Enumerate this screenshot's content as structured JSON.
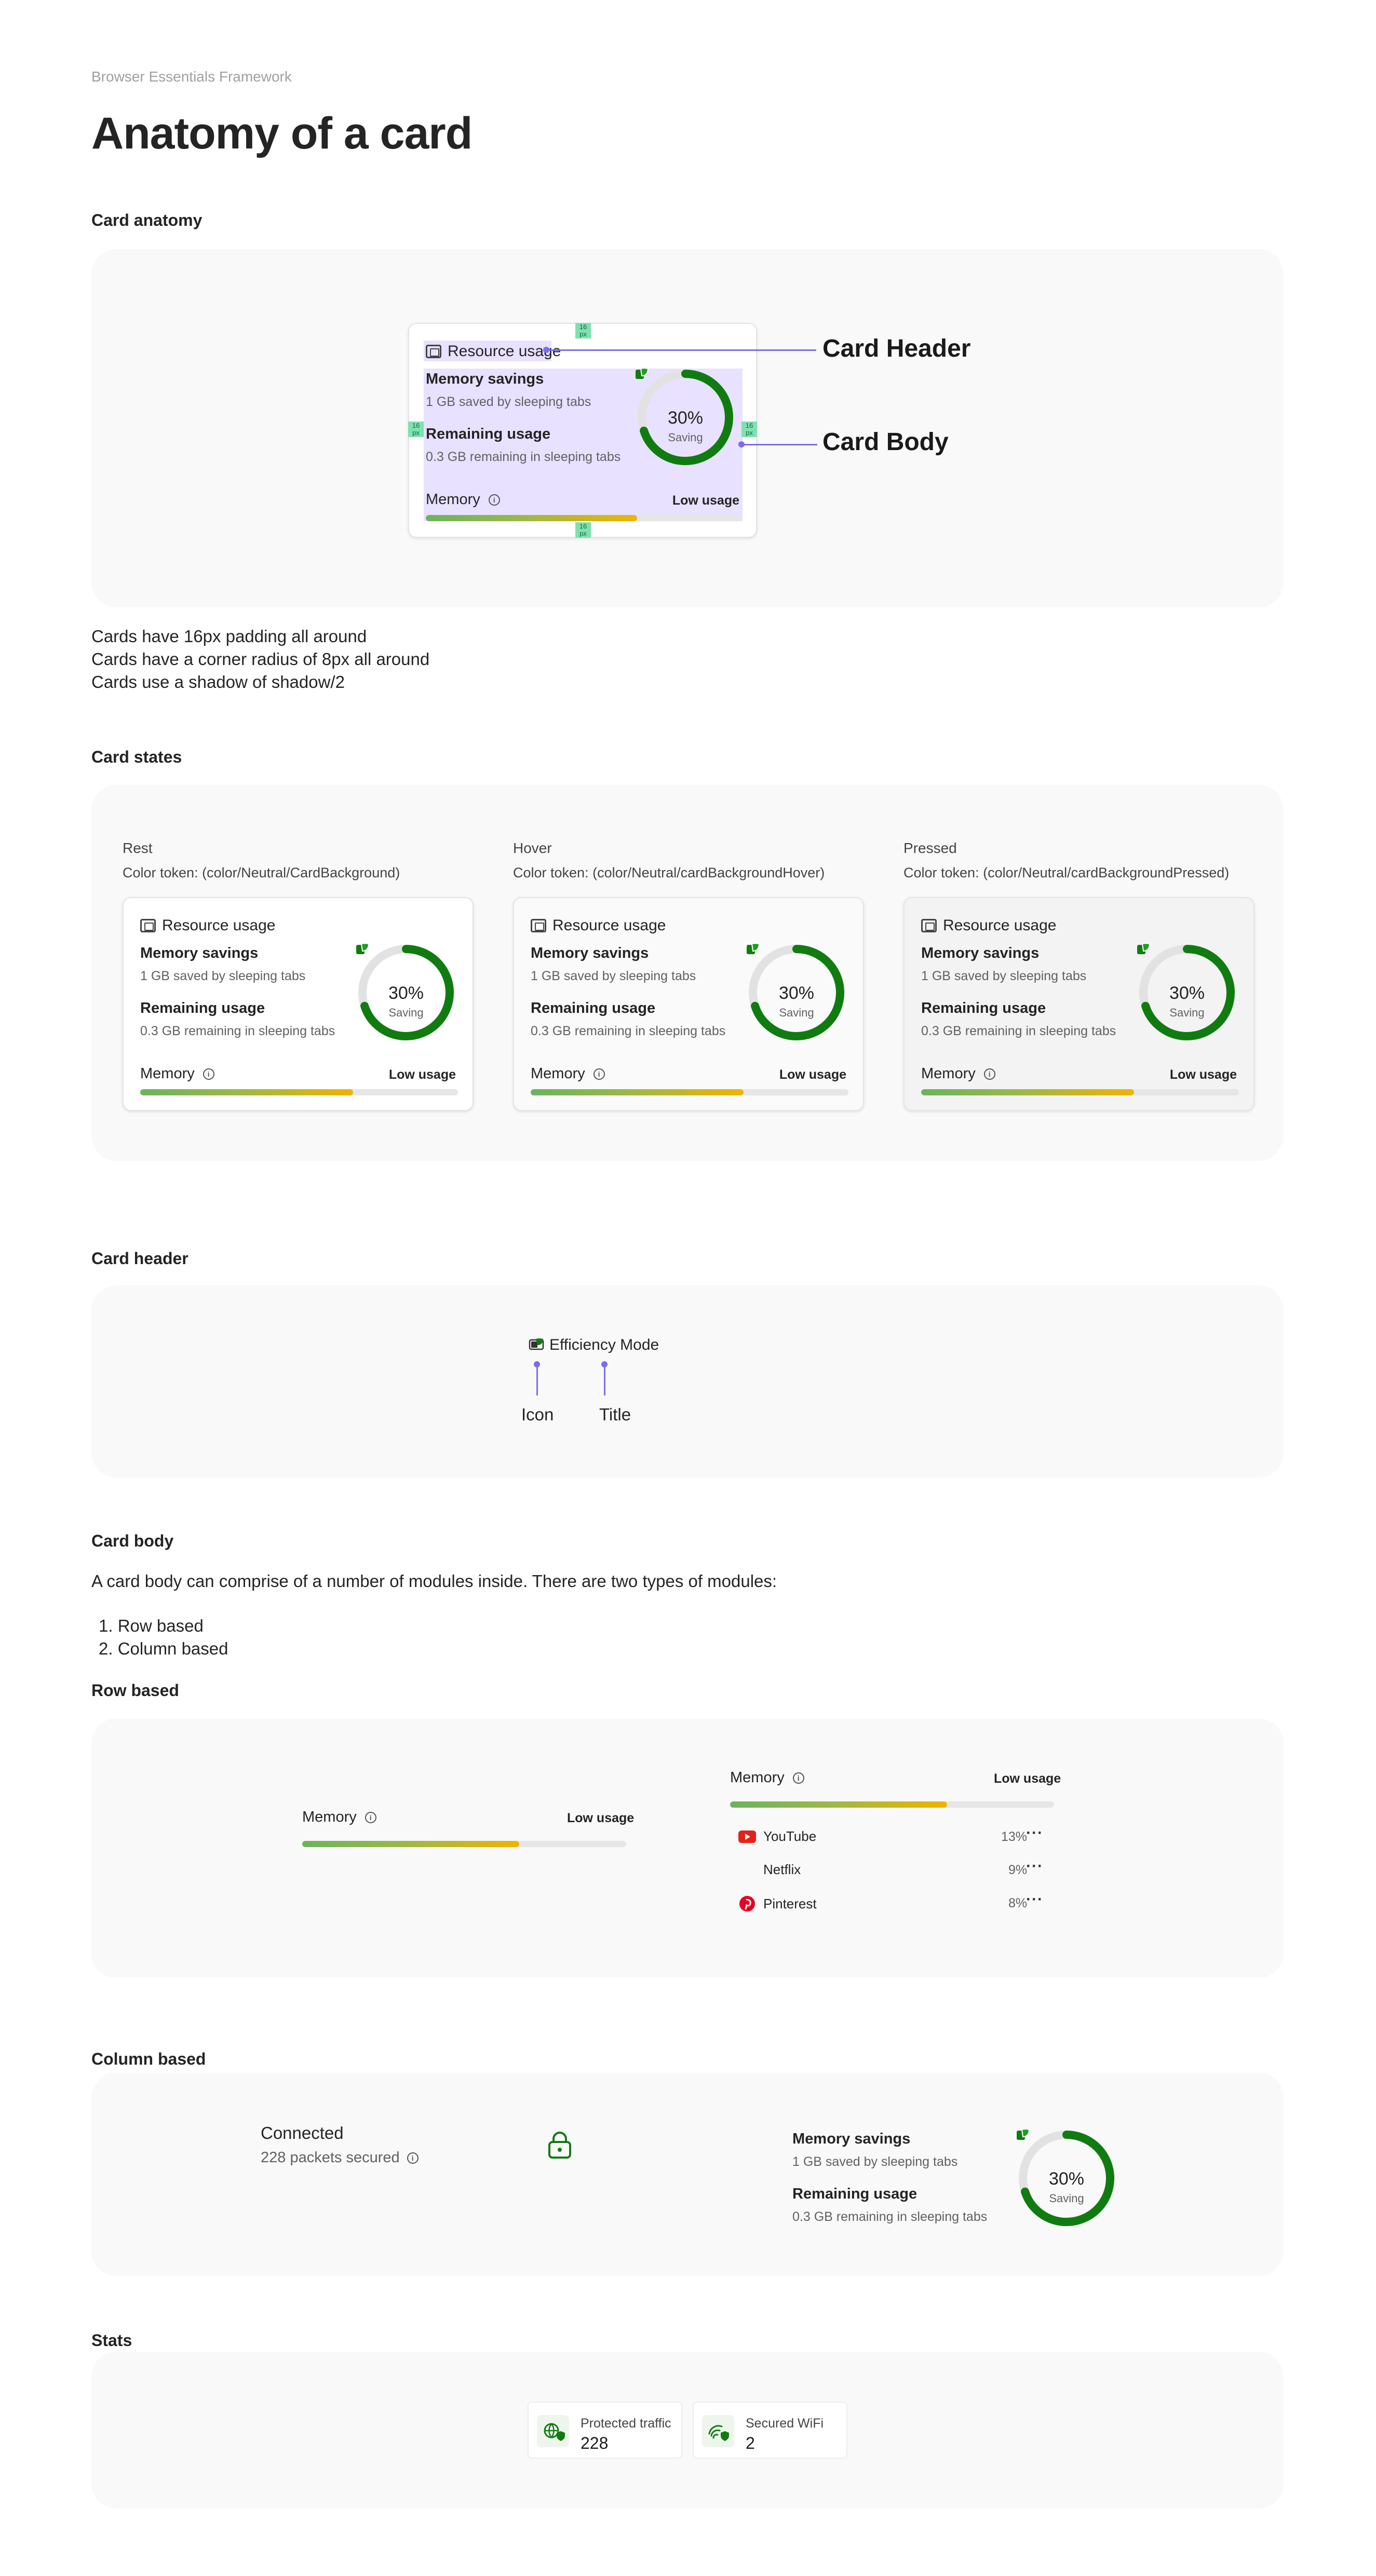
{
  "page": {
    "eyebrow": "Browser Essentials Framework",
    "title": "Anatomy of a card"
  },
  "colors": {
    "accent_green": "#107c10",
    "annotation_purple": "#7c6cf0",
    "padding_tag": "#7fe0b0",
    "bar_start": "#6bb35e",
    "bar_end": "#f0b400",
    "panel_bg": "#f9f9f9"
  },
  "card": {
    "header_icon": "chip-icon",
    "header": "Resource usage",
    "memory_savings_label": "Memory savings",
    "memory_savings_sub": "1 GB saved by sleeping tabs",
    "remaining_label": "Remaining usage",
    "remaining_sub": "0.3 GB remaining in sleeping tabs",
    "ring_value": "30%",
    "ring_percent": 30,
    "ring_sub": "Saving",
    "memory_label": "Memory",
    "memory_status": "Low usage",
    "memory_fill_percent": 67
  },
  "anatomy": {
    "section_title": "Card anatomy",
    "callout_header": "Card Header",
    "callout_body": "Card Body",
    "padding_tag": "16 px",
    "notes": [
      "Cards have 16px padding all around",
      "Cards have a corner radius of 8px all around",
      "Cards use a shadow of shadow/2"
    ]
  },
  "states": {
    "section_title": "Card states",
    "items": [
      {
        "name": "Rest",
        "token": "Color token: (color/Neutral/CardBackground)"
      },
      {
        "name": "Hover",
        "token": "Color token: (color/Neutral/cardBackgroundHover)"
      },
      {
        "name": "Pressed",
        "token": "Color token: (color/Neutral/cardBackgroundPressed)"
      }
    ]
  },
  "card_header": {
    "section_title": "Card header",
    "icon": "efficiency-mode-icon",
    "title": "Efficiency Mode",
    "label_icon": "Icon",
    "label_title": "Title"
  },
  "card_body": {
    "section_title": "Card body",
    "intro": "A card body can comprise of a number of modules inside. There are two types of modules:",
    "types": [
      "Row based",
      "Column based"
    ]
  },
  "row_based": {
    "section_title": "Row based",
    "list": [
      {
        "name": "YouTube",
        "icon": "youtube-icon",
        "pct": "13%"
      },
      {
        "name": "Netflix",
        "icon": "",
        "pct": "9%"
      },
      {
        "name": "Pinterest",
        "icon": "pinterest-icon",
        "pct": "8%"
      }
    ],
    "more": "···"
  },
  "column_based": {
    "section_title": "Column based",
    "connected_title": "Connected",
    "connected_sub": "228 packets secured",
    "lock_icon": "lock-icon"
  },
  "stats": {
    "section_title": "Stats",
    "items": [
      {
        "label": "Protected traffic",
        "value": "228",
        "icon": "globe-shield-icon"
      },
      {
        "label": "Secured WiFi",
        "value": "2",
        "icon": "wifi-shield-icon"
      }
    ]
  }
}
